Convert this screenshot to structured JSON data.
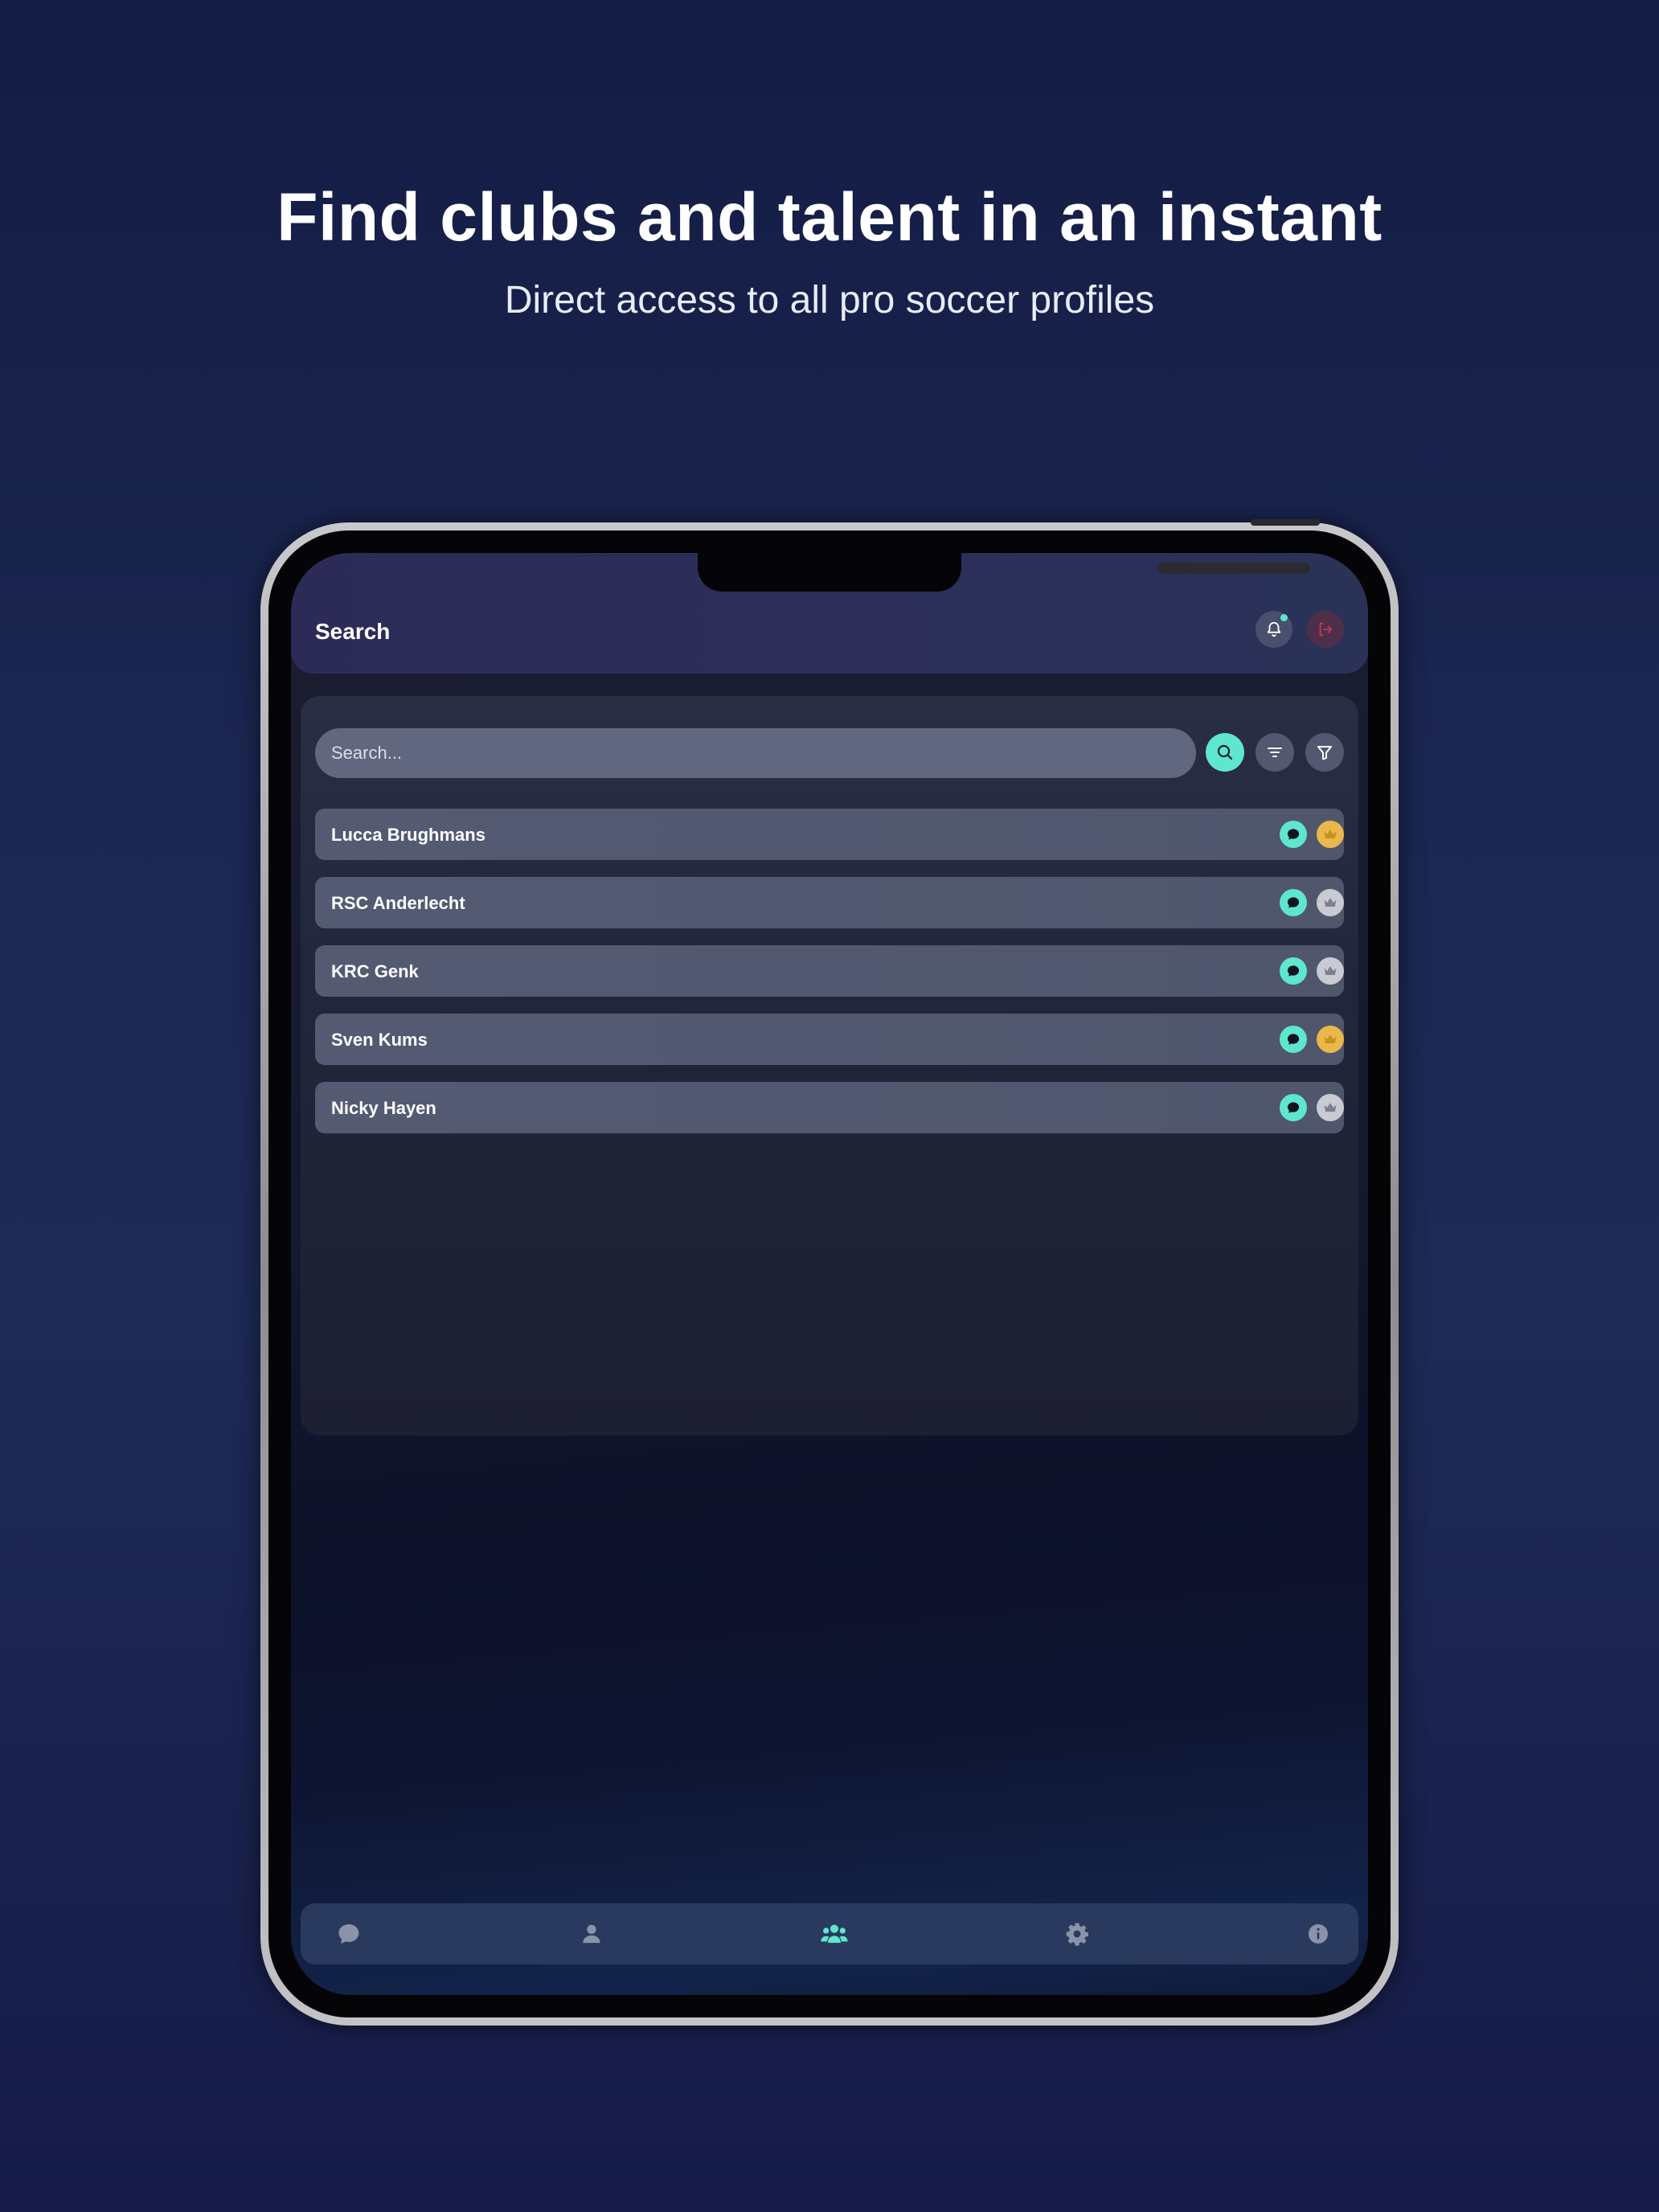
{
  "marketing": {
    "headline": "Find clubs and talent in an instant",
    "subheadline": "Direct access to all pro soccer profiles"
  },
  "header": {
    "title": "Search",
    "bell_icon": "bell-icon",
    "logout_icon": "logout-icon"
  },
  "search": {
    "placeholder": "Search...",
    "value": "",
    "search_icon": "search-icon",
    "sort_icon": "sort-icon",
    "filter_icon": "filter-icon"
  },
  "results": [
    {
      "name": "Lucca Brughmans",
      "premium": true
    },
    {
      "name": "RSC Anderlecht",
      "premium": false
    },
    {
      "name": "KRC Genk",
      "premium": false
    },
    {
      "name": "Sven Kums",
      "premium": true
    },
    {
      "name": "Nicky Hayen",
      "premium": false
    }
  ],
  "bottom_nav": [
    {
      "icon": "chat-icon",
      "active": false
    },
    {
      "icon": "profile-icon",
      "active": false
    },
    {
      "icon": "users-icon",
      "active": true
    },
    {
      "icon": "gear-icon",
      "active": false
    },
    {
      "icon": "info-icon",
      "active": false
    }
  ],
  "colors": {
    "accent": "#5ee6cf",
    "premium_gold": "#e8b84a",
    "premium_gray": "#c9cbd2",
    "logout_red": "#c23a4a",
    "nav_inactive": "#8a93a8"
  }
}
